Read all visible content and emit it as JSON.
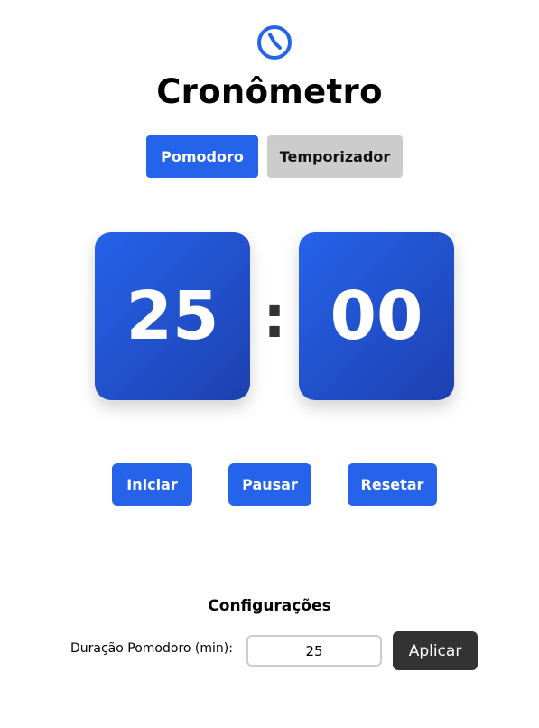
{
  "header": {
    "icon": "clock-icon",
    "title": "Cronômetro"
  },
  "modes": {
    "pomodoro_label": "Pomodoro",
    "timer_label": "Temporizador",
    "active": "Pomodoro"
  },
  "display": {
    "minutes": "25",
    "separator": ":",
    "seconds": "00"
  },
  "controls": {
    "start_label": "Iniciar",
    "pause_label": "Pausar",
    "reset_label": "Resetar"
  },
  "settings": {
    "title": "Configurações",
    "duration_label": "Duração Pomodoro (min):",
    "duration_value": "25",
    "apply_label": "Aplicar"
  },
  "colors": {
    "accent": "#2563eb",
    "accent_dark": "#1e40af",
    "inactive_button": "#cccccc",
    "apply_button": "#333333"
  }
}
